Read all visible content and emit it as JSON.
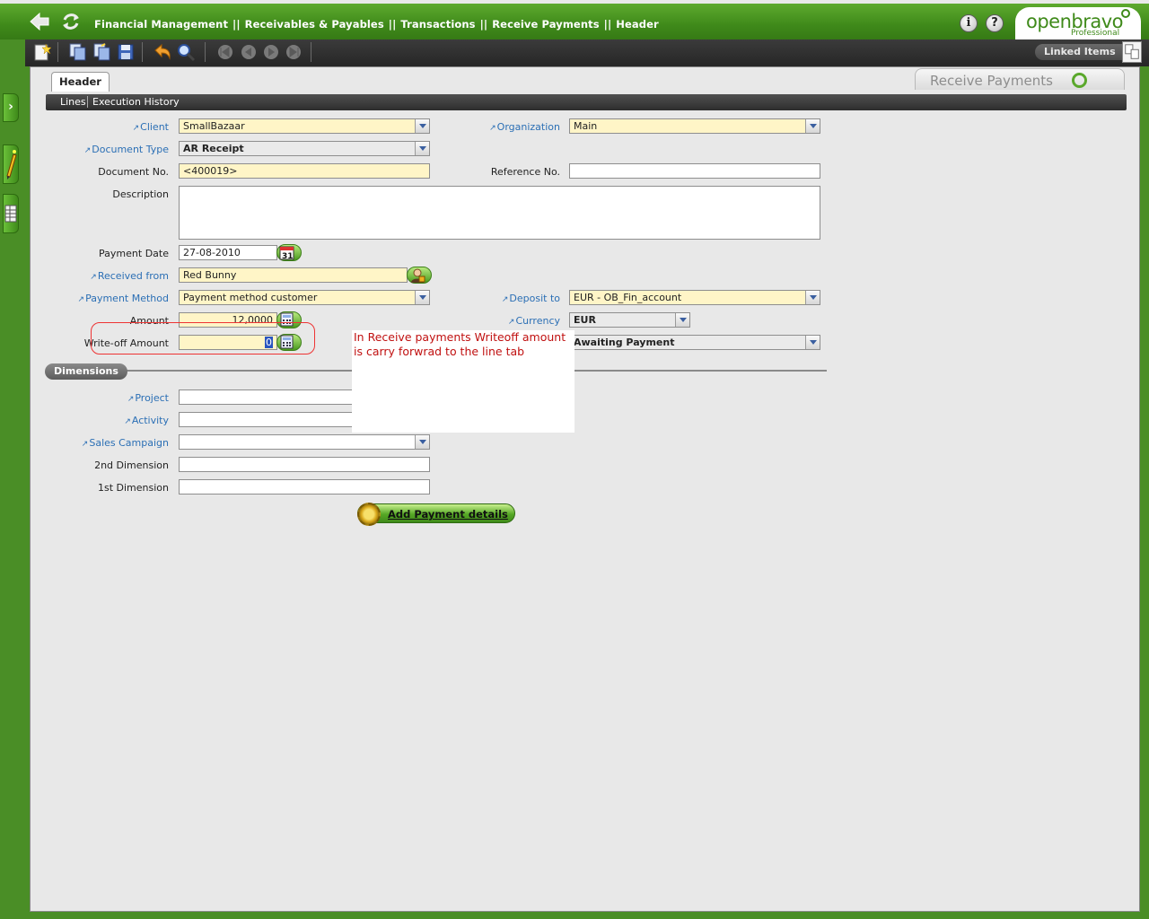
{
  "breadcrumb": {
    "items": [
      "Financial Management",
      "Receivables & Payables",
      "Transactions",
      "Receive Payments",
      "Header"
    ],
    "sep": "||",
    "last_sep": "||"
  },
  "logo": {
    "text": "openbravo",
    "sub": "Professional"
  },
  "toolbar": {
    "linked_items": "Linked Items"
  },
  "window": {
    "title": "Receive Payments"
  },
  "tabs": {
    "header": "Header",
    "subtabs": [
      "Lines",
      "Execution History"
    ]
  },
  "form": {
    "client": {
      "label": "Client",
      "value": "SmallBazaar"
    },
    "organization": {
      "label": "Organization",
      "value": "Main"
    },
    "document_type": {
      "label": "Document Type",
      "value": "AR Receipt"
    },
    "document_no": {
      "label": "Document No.",
      "value": "<400019>"
    },
    "reference_no": {
      "label": "Reference No.",
      "value": ""
    },
    "description": {
      "label": "Description",
      "value": ""
    },
    "payment_date": {
      "label": "Payment Date",
      "value": "27-08-2010"
    },
    "received_from": {
      "label": "Received from",
      "value": "Red Bunny"
    },
    "payment_method": {
      "label": "Payment Method",
      "value": "Payment method customer"
    },
    "deposit_to": {
      "label": "Deposit to",
      "value": "EUR - OB_Fin_account"
    },
    "amount": {
      "label": "Amount",
      "value": "12,0000"
    },
    "currency": {
      "label": "Currency",
      "value": "EUR"
    },
    "writeoff_amount": {
      "label": "Write-off Amount",
      "value": "0"
    },
    "status": {
      "value": "Awaiting Payment"
    }
  },
  "annotation": {
    "text": "In Receive payments Writeoff amount is carry forwrad to the line tab"
  },
  "dimensions": {
    "header": "Dimensions",
    "project": {
      "label": "Project",
      "value": ""
    },
    "activity": {
      "label": "Activity",
      "value": ""
    },
    "sales_campaign": {
      "label": "Sales Campaign",
      "value": ""
    },
    "second_dimension": {
      "label": "2nd Dimension",
      "value": ""
    },
    "first_dimension": {
      "label": "1st Dimension",
      "value": ""
    }
  },
  "actions": {
    "add_payment": "Add Payment details"
  },
  "colors": {
    "brand_green": "#4a8e26",
    "required_bg": "#fff5c7",
    "link_label": "#2b6fb5",
    "annotation_red": "#c01010"
  }
}
